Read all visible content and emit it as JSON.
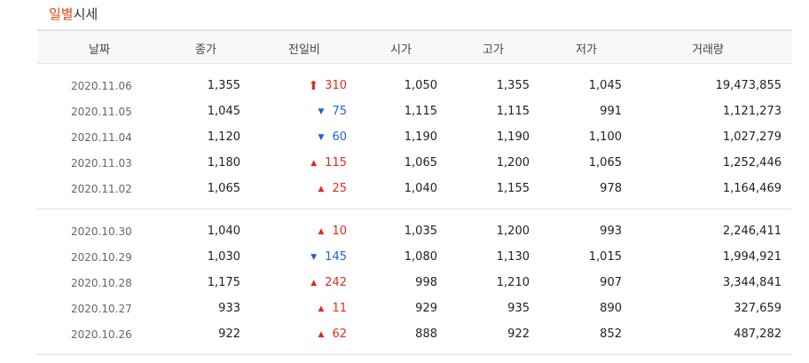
{
  "title": {
    "accent": "일별",
    "rest": "시세"
  },
  "headers": [
    "날짜",
    "종가",
    "전일비",
    "시가",
    "고가",
    "저가",
    "거래량"
  ],
  "rows": [
    {
      "date": "2020.11.06",
      "close": "1,355",
      "dir": "upper",
      "change": "310",
      "open": "1,050",
      "high": "1,355",
      "low": "1,045",
      "volume": "19,473,855"
    },
    {
      "date": "2020.11.05",
      "close": "1,045",
      "dir": "down",
      "change": "75",
      "open": "1,115",
      "high": "1,115",
      "low": "991",
      "volume": "1,121,273"
    },
    {
      "date": "2020.11.04",
      "close": "1,120",
      "dir": "down",
      "change": "60",
      "open": "1,190",
      "high": "1,190",
      "low": "1,100",
      "volume": "1,027,279"
    },
    {
      "date": "2020.11.03",
      "close": "1,180",
      "dir": "up",
      "change": "115",
      "open": "1,065",
      "high": "1,200",
      "low": "1,065",
      "volume": "1,252,446"
    },
    {
      "date": "2020.11.02",
      "close": "1,065",
      "dir": "up",
      "change": "25",
      "open": "1,040",
      "high": "1,155",
      "low": "978",
      "volume": "1,164,469"
    },
    {
      "date": "2020.10.30",
      "close": "1,040",
      "dir": "up",
      "change": "10",
      "open": "1,035",
      "high": "1,200",
      "low": "993",
      "volume": "2,246,411"
    },
    {
      "date": "2020.10.29",
      "close": "1,030",
      "dir": "down",
      "change": "145",
      "open": "1,080",
      "high": "1,130",
      "low": "1,015",
      "volume": "1,994,921"
    },
    {
      "date": "2020.10.28",
      "close": "1,175",
      "dir": "up",
      "change": "242",
      "open": "998",
      "high": "1,210",
      "low": "907",
      "volume": "3,344,841"
    },
    {
      "date": "2020.10.27",
      "close": "933",
      "dir": "up",
      "change": "11",
      "open": "929",
      "high": "935",
      "low": "890",
      "volume": "327,659"
    },
    {
      "date": "2020.10.26",
      "close": "922",
      "dir": "up",
      "change": "62",
      "open": "888",
      "high": "922",
      "low": "852",
      "volume": "487,282"
    }
  ],
  "colors": {
    "up": "#e12b1f",
    "down": "#1e62d0",
    "accent": "#e8441a"
  }
}
